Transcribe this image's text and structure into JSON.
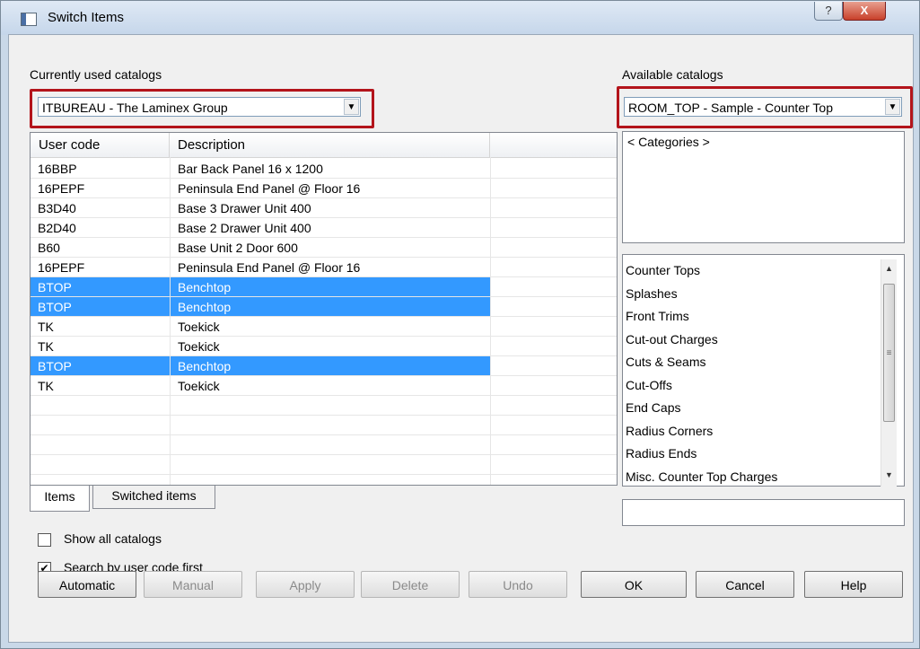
{
  "window": {
    "title": "Switch Items",
    "help_glyph": "?",
    "close_glyph": "X"
  },
  "left": {
    "label": "Currently used catalogs",
    "catalog_value": "ITBUREAU - The Laminex Group",
    "columns": [
      "User code",
      "Description"
    ],
    "rows": [
      {
        "code": "16BBP",
        "desc": "Bar Back Panel 16 x 1200",
        "selected": false
      },
      {
        "code": "16PEPF",
        "desc": "Peninsula End Panel @ Floor 16",
        "selected": false
      },
      {
        "code": "B3D40",
        "desc": "Base 3 Drawer Unit 400",
        "selected": false
      },
      {
        "code": "B2D40",
        "desc": "Base 2 Drawer Unit 400",
        "selected": false
      },
      {
        "code": "B60",
        "desc": "Base Unit 2 Door 600",
        "selected": false
      },
      {
        "code": "16PEPF",
        "desc": "Peninsula End Panel @ Floor 16",
        "selected": false
      },
      {
        "code": "BTOP",
        "desc": "Benchtop",
        "selected": true
      },
      {
        "code": "BTOP",
        "desc": "Benchtop",
        "selected": true
      },
      {
        "code": "TK",
        "desc": "Toekick",
        "selected": false
      },
      {
        "code": "TK",
        "desc": "Toekick",
        "selected": false
      },
      {
        "code": "BTOP",
        "desc": "Benchtop",
        "selected": true
      },
      {
        "code": "TK",
        "desc": "Toekick",
        "selected": false
      }
    ],
    "tabs": [
      "Items",
      "Switched items"
    ],
    "active_tab": "Items"
  },
  "options": {
    "show_all_catalogs": {
      "label": "Show all catalogs",
      "checked": false
    },
    "search_by_code": {
      "label": "Search by user code first",
      "checked": true,
      "mark": "✔"
    }
  },
  "right": {
    "label": "Available catalogs",
    "catalog_value": "ROOM_TOP - Sample - Counter Top",
    "categories_item": "< Categories >",
    "items": [
      "Counter Tops",
      "Splashes",
      "Front Trims",
      "Cut-out Charges",
      "Cuts & Seams",
      "Cut-Offs",
      "End Caps",
      "Radius Corners",
      "Radius Ends",
      "Misc. Counter Top Charges"
    ],
    "search_value": ""
  },
  "buttons": {
    "automatic": "Automatic",
    "manual": "Manual",
    "apply": "Apply",
    "delete": "Delete",
    "undo": "Undo",
    "ok": "OK",
    "cancel": "Cancel",
    "help": "Help"
  },
  "colors": {
    "selection": "#3399ff",
    "highlight_border": "#b3141b"
  }
}
